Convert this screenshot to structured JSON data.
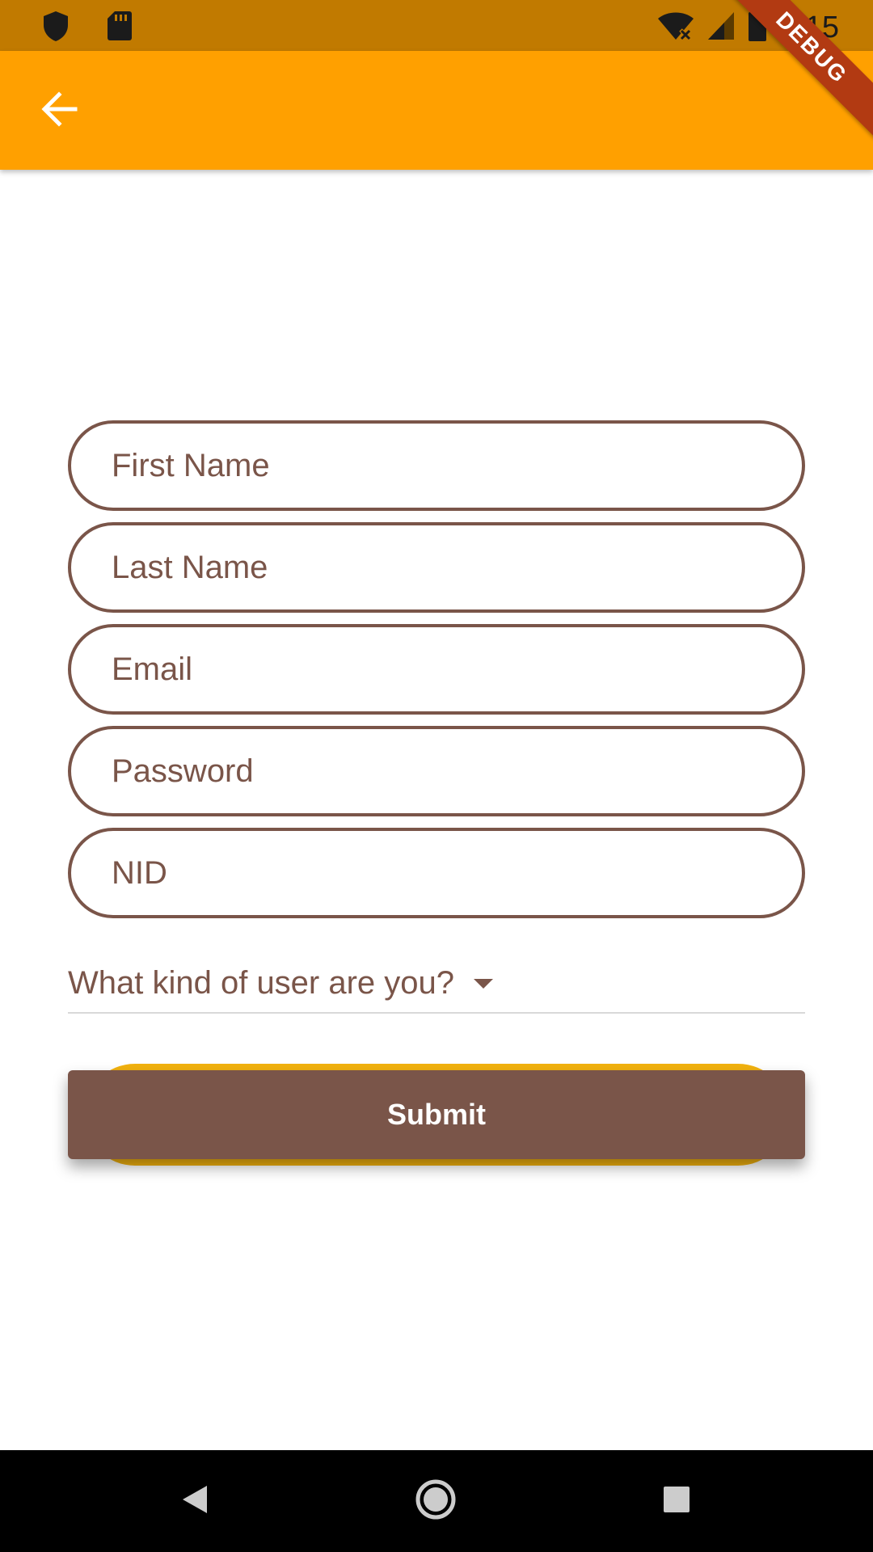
{
  "status_bar": {
    "time": "7:15",
    "left_icons": [
      "shield-icon",
      "sd-card-icon"
    ],
    "right_icons": [
      "wifi-off-icon",
      "cell-signal-icon",
      "battery-icon"
    ]
  },
  "app_bar": {
    "back_icon": "arrow-back-icon",
    "debug_banner": "DEBUG"
  },
  "form": {
    "fields": [
      {
        "placeholder": "First Name",
        "value": ""
      },
      {
        "placeholder": "Last Name",
        "value": ""
      },
      {
        "placeholder": "Email",
        "value": ""
      },
      {
        "placeholder": "Password",
        "value": ""
      },
      {
        "placeholder": "NID",
        "value": ""
      }
    ],
    "dropdown": {
      "label": "What kind of user are you?",
      "icon": "arrow-drop-down-icon"
    },
    "submit_label": "Submit"
  },
  "nav_bar": {
    "icons": [
      "back-triangle-icon",
      "home-circle-icon",
      "recents-square-icon"
    ]
  },
  "colors": {
    "status_bar": "#C17A00",
    "app_bar": "#FFA000",
    "accent_brown": "#7A5549",
    "button_glow": "#F2B20F",
    "debug_ribbon": "#B23A12"
  }
}
